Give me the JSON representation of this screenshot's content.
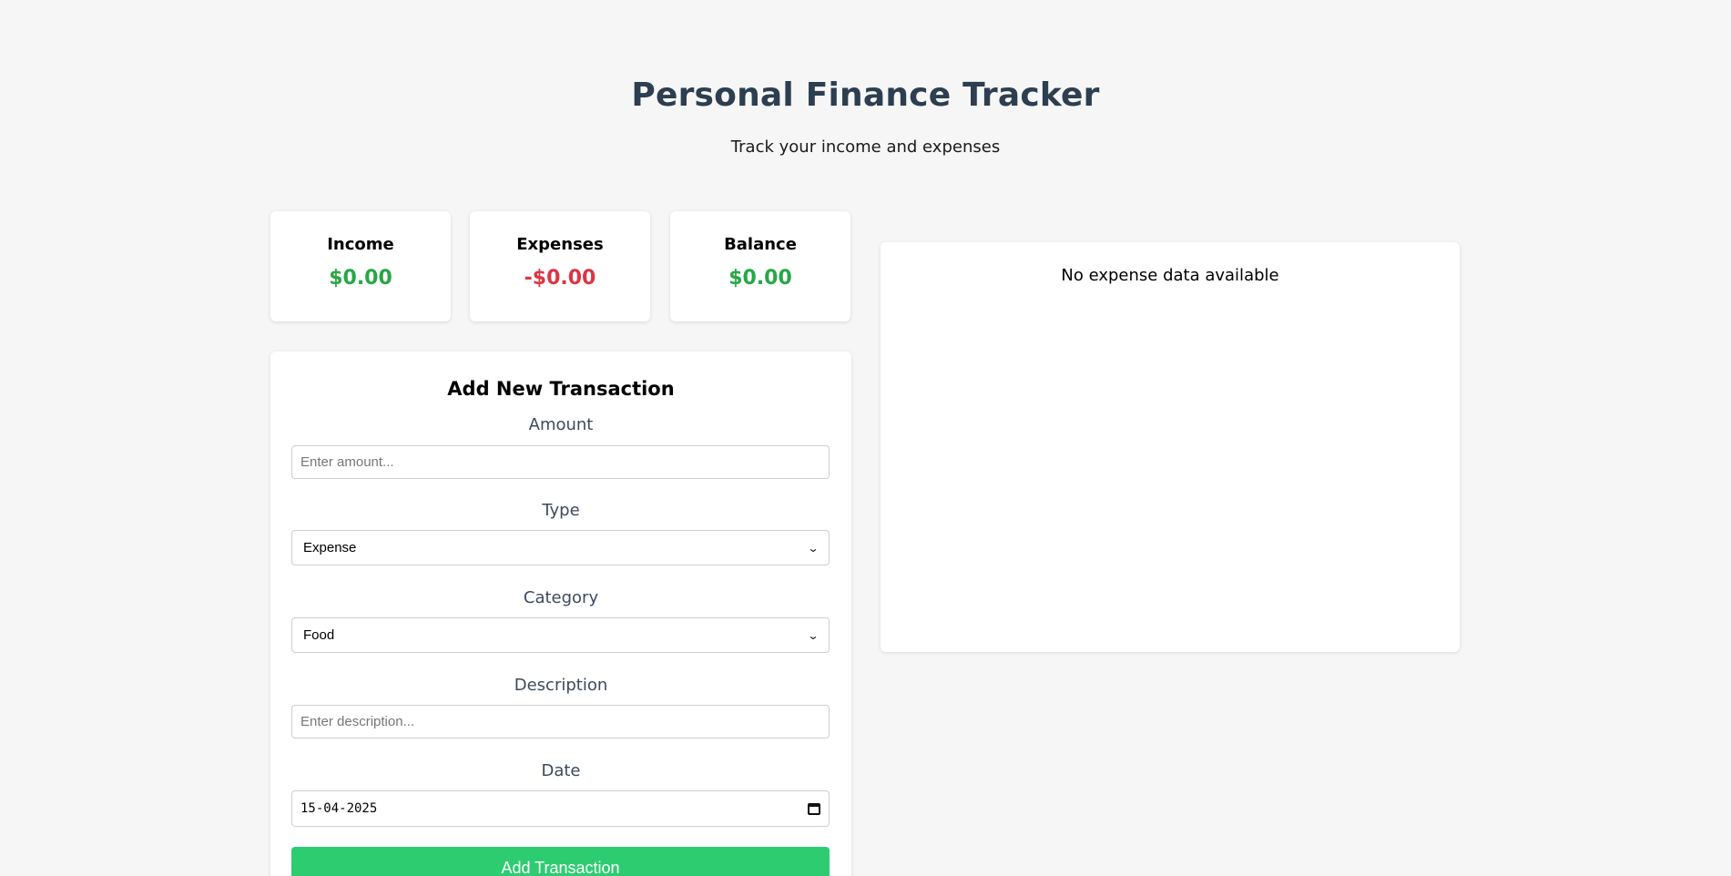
{
  "header": {
    "title": "Personal Finance Tracker",
    "subtitle": "Track your income and expenses"
  },
  "summary": {
    "income": {
      "label": "Income",
      "value": "$0.00",
      "color": "#28a745"
    },
    "expenses": {
      "label": "Expenses",
      "value": "-$0.00",
      "color": "#dc3545"
    },
    "balance": {
      "label": "Balance",
      "value": "$0.00",
      "color": "#28a745"
    }
  },
  "form": {
    "title": "Add New Transaction",
    "amount": {
      "label": "Amount",
      "placeholder": "Enter amount..."
    },
    "type": {
      "label": "Type",
      "selected": "Expense",
      "icon": "chevron-down-icon"
    },
    "category": {
      "label": "Category",
      "selected": "Food",
      "icon": "chevron-down-icon"
    },
    "description": {
      "label": "Description",
      "placeholder": "Enter description..."
    },
    "date": {
      "label": "Date",
      "value": "15-04-2025",
      "icon": "calendar-icon"
    },
    "submit_label": "Add Transaction",
    "submit_color": "#2ecc71"
  },
  "chart": {
    "empty_message": "No expense data available"
  }
}
